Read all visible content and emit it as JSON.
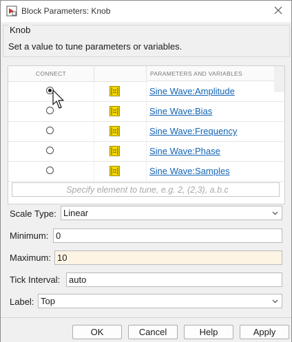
{
  "window": {
    "title": "Block Parameters: Knob"
  },
  "group": {
    "title": "Knob",
    "description": "Set a value to tune parameters or variables."
  },
  "table": {
    "headers": {
      "connect": "CONNECT",
      "icon": "",
      "params": "PARAMETERS AND VARIABLES"
    },
    "rows": [
      {
        "param": "Sine Wave:Amplitude",
        "checked": true
      },
      {
        "param": "Sine Wave:Bias",
        "checked": false
      },
      {
        "param": "Sine Wave:Frequency",
        "checked": false
      },
      {
        "param": "Sine Wave:Phase",
        "checked": false
      },
      {
        "param": "Sine Wave:Samples",
        "checked": false
      }
    ],
    "element_placeholder": "Specify element to tune, e.g. 2, (2,3), a.b.c"
  },
  "form": {
    "scale_type": {
      "label": "Scale Type:",
      "value": "Linear"
    },
    "minimum": {
      "label": "Minimum:",
      "value": "0"
    },
    "maximum": {
      "label": "Maximum:",
      "value": "10"
    },
    "tick_interval": {
      "label": "Tick Interval:",
      "value": "auto"
    },
    "label": {
      "label": "Label:",
      "value": "Top"
    }
  },
  "buttons": {
    "ok": "OK",
    "cancel": "Cancel",
    "help": "Help",
    "apply": "Apply"
  },
  "colors": {
    "link": "#1264b4",
    "highlight_field": "#fef4e4",
    "variable_icon": "#e8c200"
  }
}
